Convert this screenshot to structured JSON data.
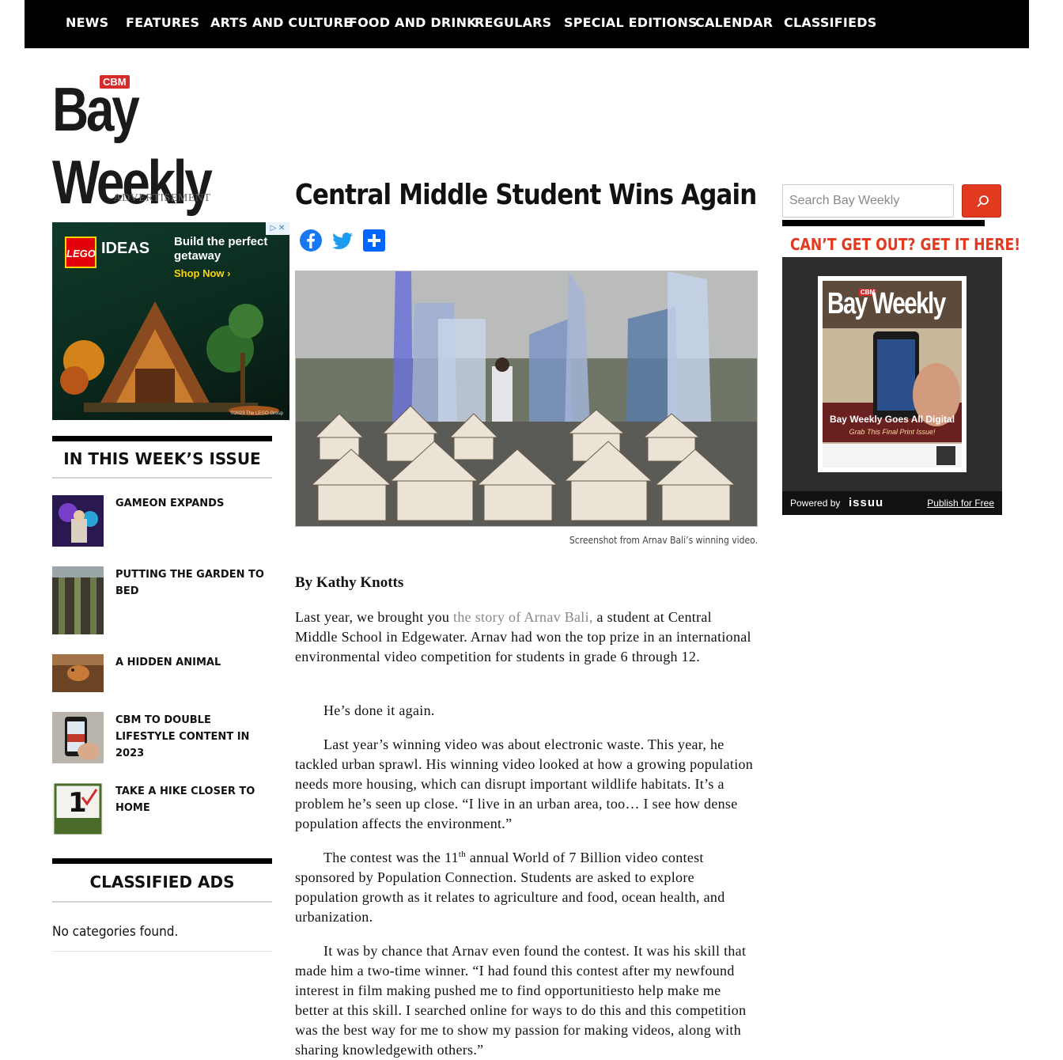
{
  "nav": {
    "items": [
      "NEWS",
      "FEATURES",
      "ARTS AND CULTURE",
      "FOOD AND DRINK",
      "REGULARS",
      "SPECIAL EDITIONS",
      "CALENDAR",
      "CLASSIFIEDS"
    ]
  },
  "logo": {
    "badge": "CBM",
    "name": "Bay Weekly"
  },
  "left_sidebar": {
    "ad_label": "ADVERTISEMENT",
    "ad": {
      "brand_badge": "LEGO",
      "brand_line": "IDEAS",
      "headline": "Build the perfect getaway",
      "cta": "Shop Now ›",
      "copyright": "©2023 The LEGO Group"
    },
    "issue_heading": "IN THIS WEEK’S ISSUE",
    "issue_items": [
      {
        "title": "GAMEON EXPANDS"
      },
      {
        "title": "PUTTING THE GARDEN TO BED"
      },
      {
        "title": "A HIDDEN ANIMAL"
      },
      {
        "title": "CBM TO DOUBLE LIFESTYLE CONTENT IN 2023"
      },
      {
        "title": "TAKE A HIKE CLOSER TO HOME"
      }
    ],
    "classified_heading": "CLASSIFIED ADS",
    "classified_empty": "No categories found."
  },
  "article": {
    "title": "Central Middle Student Wins Again",
    "share": [
      "facebook-icon",
      "twitter-icon",
      "share-icon"
    ],
    "image_caption": "Screenshot from Arnav Bali’s winning video.",
    "byline": "By Kathy Knotts",
    "p1_pre": "Last year, we brought you ",
    "p1_link": "the story of Arnav Bali,",
    "p1_post": " a student at Central Middle School in Edgewater. Arnav had won the top prize in an international environmental video competition for students in grade 6 through 12.",
    "p2": "He’s done it again.",
    "p3": "Last year’s winning video was about electronic waste. This year, he tackled urban sprawl. His winning video looked at how a growing population needs more housing, which can disrupt important wildlife habitats. It’s a problem he’s seen up close. “I live in an urban area, too… I see how dense population affects the environment.”",
    "p4_pre": "The contest was the 11",
    "p4_sup": "th",
    "p4_post": " annual World of 7 Billion video contest sponsored by Population Connection. Students are asked to explore population growth as it relates to agriculture and food, ocean health, and urbanization.",
    "p5": "It was by chance that Arnav even found the contest. It was his skill that made him a two-time winner. “I had found this contest after my newfound interest in film making pushed me to find opportunitiesto help make me better at this skill. I searched online for ways to do this and this competition was the best way for me to show my passion for making videos, along with sharing knowledgewith others.”"
  },
  "right_sidebar": {
    "search_placeholder": "Search Bay Weekly",
    "promo_heading": "CAN’T GET OUT? GET IT HERE!",
    "cover": {
      "masthead": "Bay Weekly",
      "badge": "CBM",
      "headline": "Bay Weekly Goes All Digital",
      "subhead": "Grab This Final Print Issue!"
    },
    "powered_by": "Powered by",
    "issuu_brand": "issuu",
    "publish_link": "Publish for Free"
  },
  "colors": {
    "accent_red": "#e23a1f",
    "nav_bg": "#000000",
    "link_gray": "#888888"
  }
}
